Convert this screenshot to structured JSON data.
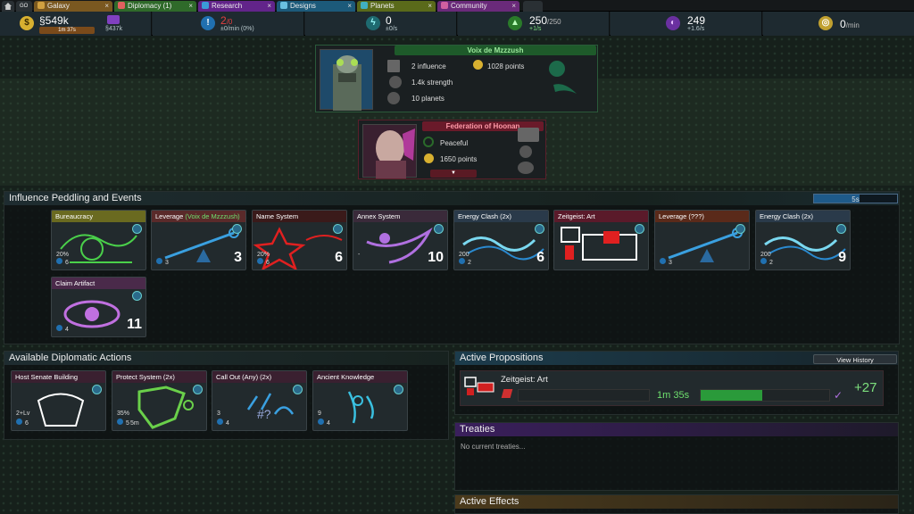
{
  "tabs": [
    {
      "label": "",
      "icon": "home-icon"
    },
    {
      "label": "GO",
      "icon": ""
    },
    {
      "label": "Galaxy",
      "icon": "galaxy-icon"
    },
    {
      "label": "Diplomacy (1)",
      "icon": "diplomacy-icon"
    },
    {
      "label": "Research",
      "icon": "research-icon"
    },
    {
      "label": "Designs",
      "icon": "designs-icon"
    },
    {
      "label": "Planets",
      "icon": "planets-icon"
    },
    {
      "label": "Community",
      "icon": "community-icon"
    }
  ],
  "resources": {
    "money": {
      "value": "§549k",
      "sub": "1m 37s",
      "sub2": "§437k",
      "color": "#e0c040"
    },
    "influence": {
      "value": "2",
      "max": "/0",
      "sub": "±0/min (0%)",
      "color": "#3a9ad8"
    },
    "energy": {
      "value": "0",
      "sub": "±0/s",
      "color": "#40c0a0"
    },
    "ftl": {
      "value": "250",
      "max": "/250",
      "sub": "+1/s",
      "color": "#5cc050"
    },
    "research": {
      "value": "249",
      "sub": "+1.6/s",
      "color": "#9050d0"
    },
    "defense": {
      "value": "0",
      "unit": "/min",
      "color": "#d8c040"
    }
  },
  "empires": {
    "self": {
      "name": "Voix de Mzzzush",
      "influence": "2 influence",
      "strength": "1.4k strength",
      "planets": "10 planets",
      "points": "1028 points"
    },
    "other": {
      "name": "Federation of Hoonan",
      "status": "Peaceful",
      "points": "1650 points",
      "expand": "▼"
    }
  },
  "peddling": {
    "title": "Influence Peddling and Events",
    "timer": "5s",
    "timer_progress": 0.55,
    "cards": [
      {
        "title": "Bureaucracy",
        "pct": "20%",
        "cost": "6",
        "value": "",
        "color": "#6a6a20"
      },
      {
        "title": "Leverage ",
        "title_extra": "(Voix de Mzzzush)",
        "cost": "3",
        "value": "3",
        "color": "#5a2a2a"
      },
      {
        "title": "Name System",
        "pct": "20%",
        "cost": "6",
        "value": "6",
        "color": "#3a1a1a"
      },
      {
        "title": "Annex System",
        "sub": "-",
        "value": "10",
        "color": "#3a2a3a"
      },
      {
        "title": "Energy Clash (2x)",
        "sub": "200",
        "cost": "2",
        "value": "6",
        "color": "#2a3a4a"
      },
      {
        "title": "Zeitgeist: Art",
        "color": "#5a1a2a"
      },
      {
        "title": "Leverage (???)",
        "cost": "3",
        "color": "#5a2a1a"
      },
      {
        "title": "Energy Clash (2x)",
        "sub": "200",
        "cost": "2",
        "value": "9",
        "color": "#2a3a4a"
      },
      {
        "title": "Claim Artifact",
        "cost": "4",
        "value": "11",
        "color": "#4a2a4a"
      }
    ]
  },
  "diplomatic": {
    "title": "Available Diplomatic Actions",
    "cards": [
      {
        "title": "Host Senate Building",
        "sub": "2+Lv",
        "cost": "6",
        "color": "#3a2030"
      },
      {
        "title": "Protect System (2x)",
        "sub": "35%",
        "sub2": "5m",
        "cost": "5",
        "color": "#3a2030"
      },
      {
        "title": "Call Out (Any) (2x)",
        "sub": "3",
        "cost": "4",
        "color": "#3a2030"
      },
      {
        "title": "Ancient Knowledge",
        "sub": "9",
        "cost": "4",
        "color": "#3a2030"
      }
    ]
  },
  "propositions": {
    "title": "Active Propositions",
    "history": "View History",
    "item": {
      "name": "Zeitgeist: Art",
      "time": "1m 35s",
      "progress": 0.48,
      "score": "+27"
    }
  },
  "treaties": {
    "title": "Treaties",
    "empty": "No current treaties..."
  },
  "effects": {
    "title": "Active Effects"
  }
}
